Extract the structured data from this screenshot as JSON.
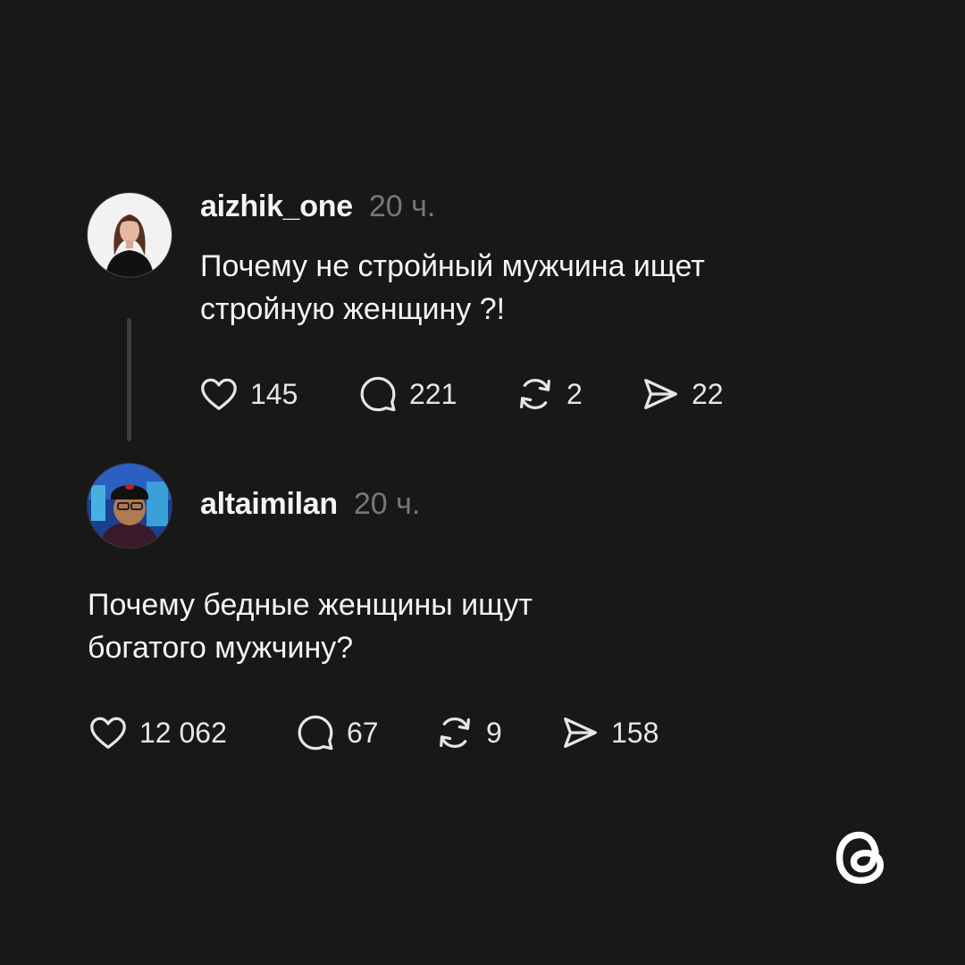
{
  "post1": {
    "username": "aizhik_one",
    "time": "20 ч.",
    "text": "Почему не стройный мужчина ищет\nстройную женщину ?!",
    "likes": "145",
    "replies": "221",
    "reposts": "2",
    "shares": "22"
  },
  "post2": {
    "username": "altaimilan",
    "time": "20 ч.",
    "text": "Почему бедные женщины ищут\nбогатого мужчину?",
    "likes": "12 062",
    "replies": "67",
    "reposts": "9",
    "shares": "158"
  },
  "icons": {
    "like": "heart-icon",
    "reply": "speech-bubble-icon",
    "repost": "repost-arrows-icon",
    "share": "paper-plane-icon",
    "brand": "threads-logo"
  },
  "colors": {
    "background": "#181818",
    "text": "#f3f5f7",
    "muted": "#777777",
    "thread_line": "#3d3d3d"
  }
}
